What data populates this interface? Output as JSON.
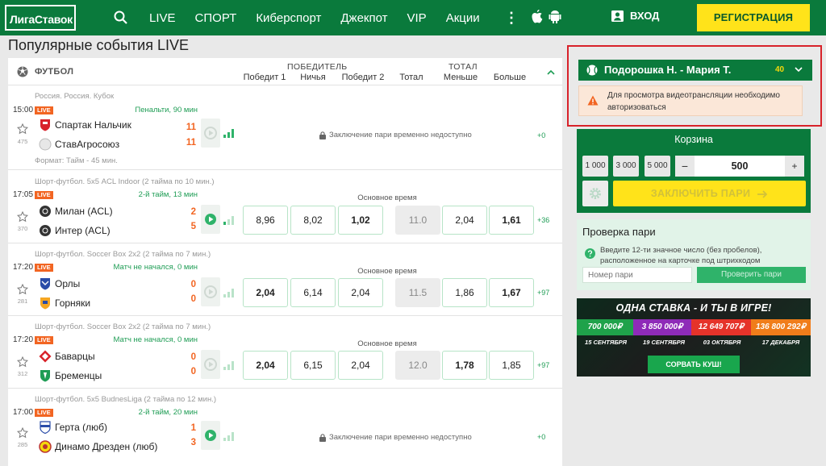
{
  "header": {
    "logo": "ЛигаСтавок",
    "nav": [
      "LIVE",
      "СПОРТ",
      "Киберспорт",
      "Джекпот",
      "VIP",
      "Акции"
    ],
    "login": "ВХОД",
    "register": "РЕГИСТРАЦИЯ"
  },
  "page_title": "Популярные события LIVE",
  "table": {
    "sport": "ФУТБОЛ",
    "group_winner": "ПОБЕДИТЕЛЬ",
    "group_total": "ТОТАЛ",
    "col_w1": "Победит 1",
    "col_draw": "Ничья",
    "col_w2": "Победит 2",
    "col_total": "Тотал",
    "col_under": "Меньше",
    "col_over": "Больше"
  },
  "events": [
    {
      "league": "Россия. Россия. Кубок",
      "time": "15:00",
      "live": "LIVE",
      "status": "Пенальти, 90 мин",
      "team1": "Спартак Нальчик",
      "team2": "СтавАгросоюз",
      "score1": "11",
      "score2": "11",
      "count": "475",
      "locked": "Заключение пари временно недоступно",
      "more": "+0",
      "format": "Формат: Тайм - 45 мин."
    },
    {
      "league": "Шорт-футбол. 5х5 ACL Indoor (2 тайма по 10 мин.)",
      "time": "17:05",
      "live": "LIVE",
      "status": "2-й тайм, 13 мин",
      "team1": "Милан (ACL)",
      "team2": "Интер (ACL)",
      "score1": "2",
      "score2": "5",
      "count": "370",
      "period": "Основное время",
      "odds": [
        "8,96",
        "8,02",
        "1,02",
        "11.0",
        "2,04",
        "1,61"
      ],
      "more": "+36"
    },
    {
      "league": "Шорт-футбол. Soccer Box 2х2 (2 тайма по 7 мин.)",
      "time": "17:20",
      "live": "LIVE",
      "status": "Матч не начался, 0 мин",
      "team1": "Орлы",
      "team2": "Горняки",
      "score1": "0",
      "score2": "0",
      "count": "281",
      "period": "Основное время",
      "odds": [
        "2,04",
        "6,14",
        "2,04",
        "11.5",
        "1,86",
        "1,67"
      ],
      "more": "+97"
    },
    {
      "league": "Шорт-футбол. Soccer Box 2х2 (2 тайма по 7 мин.)",
      "time": "17:20",
      "live": "LIVE",
      "status": "Матч не начался, 0 мин",
      "team1": "Баварцы",
      "team2": "Бременцы",
      "score1": "0",
      "score2": "0",
      "count": "312",
      "period": "Основное время",
      "odds": [
        "2,04",
        "6,15",
        "2,04",
        "12.0",
        "1,78",
        "1,85"
      ],
      "more": "+97"
    },
    {
      "league": "Шорт-футбол. 5х5 BudnesLiga (2 тайма по 12 мин.)",
      "time": "17:00",
      "live": "LIVE",
      "status": "2-й тайм, 20 мин",
      "team1": "Герта (люб)",
      "team2": "Динамо Дрезден (люб)",
      "score1": "1",
      "score2": "3",
      "count": "285",
      "locked": "Заключение пари временно недоступно",
      "more": "+0"
    }
  ],
  "video_box": {
    "match": "Подорошка Н. - Мария Т.",
    "count": "40",
    "warning": "Для просмотра видеотрансляции необходимо авторизоваться"
  },
  "basket": {
    "title": "Корзина",
    "quick": [
      "1 000",
      "3 000",
      "5 000"
    ],
    "minus": "−",
    "amount": "500",
    "plus": "+",
    "place": "ЗАКЛЮЧИТЬ ПАРИ"
  },
  "check": {
    "title": "Проверка пари",
    "hint": "Введите 12-ти значное число (без пробелов), расположенное на карточке под штрихкодом",
    "placeholder": "Номер пари",
    "button": "Проверить пари"
  },
  "promo": {
    "title": "ОДНА СТАВКА - И ТЫ В ИГРЕ!",
    "prizes": [
      "700 000₽",
      "3 850 000₽",
      "12 649 707₽",
      "136 800 292₽"
    ],
    "prize_colors": [
      "#1fa24a",
      "#8e2bb8",
      "#e5332a",
      "#f07d1a"
    ],
    "dates": [
      "15 СЕНТЯБРЯ",
      "19 СЕНТЯБРЯ",
      "03 ОКТЯБРЯ",
      "17 ДЕКАБРЯ"
    ],
    "button": "СОРВАТЬ КУШ!"
  },
  "colors": {
    "brand_green": "#0a7a3c",
    "accent_yellow": "#ffe31a",
    "live_orange": "#f26522",
    "highlight_red": "#d8222a"
  }
}
